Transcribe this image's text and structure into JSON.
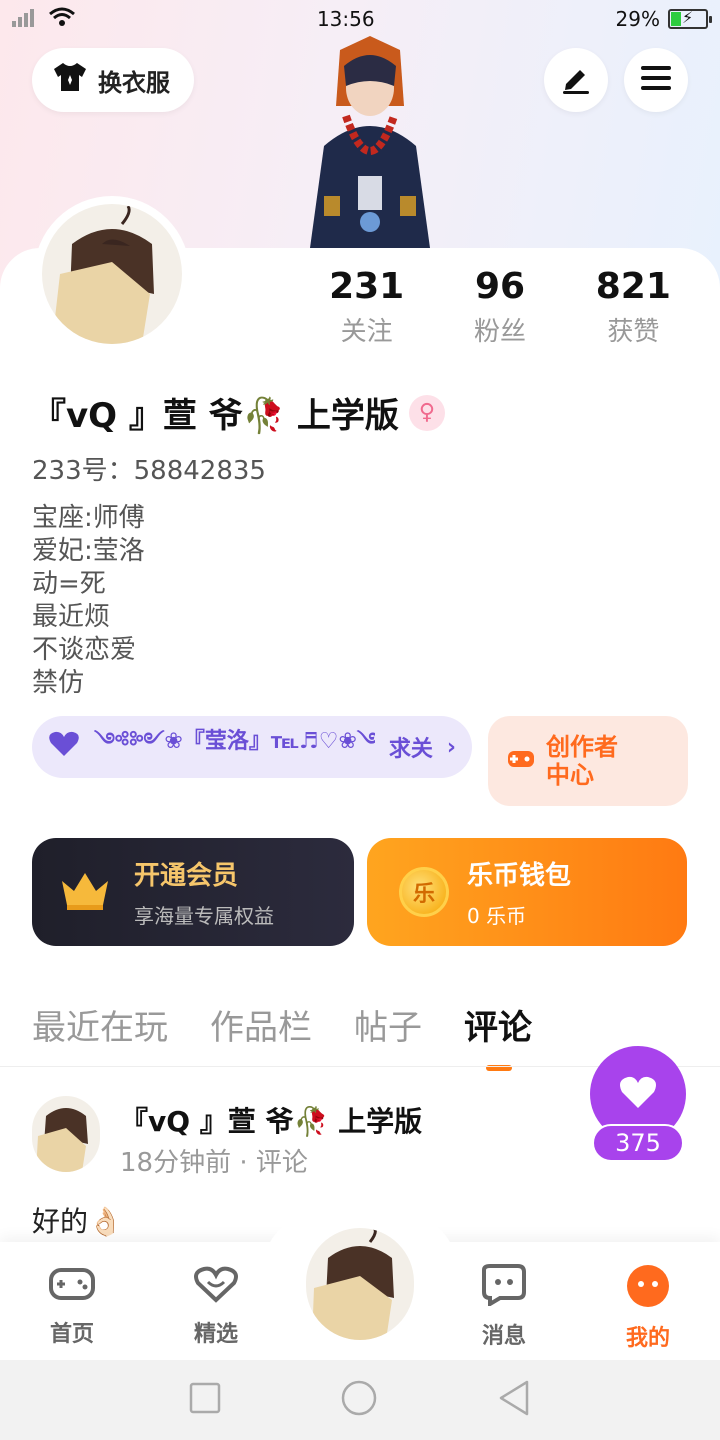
{
  "status": {
    "time": "13:56",
    "battery": "29%"
  },
  "header": {
    "dress_label": "换衣服"
  },
  "stats": [
    {
      "num": "231",
      "label": "关注"
    },
    {
      "num": "96",
      "label": "粉丝"
    },
    {
      "num": "821",
      "label": "获赞"
    }
  ],
  "profile": {
    "nickname": "『vQ 』萱 爷🥀 上学版",
    "uid": "233号：58842835",
    "bio": [
      "宝座:师傅",
      "爱妃:莹洛",
      "动=死",
      "最近烦",
      "不谈恋爱",
      "禁仿"
    ]
  },
  "guard": {
    "text": "༺༻❀『莹洛』℡♬♡❀༺༻",
    "action": "求关"
  },
  "creator": {
    "label_line1": "创作者",
    "label_line2": "中心"
  },
  "vip": {
    "title": "开通会员",
    "sub": "享海量专属权益"
  },
  "wallet": {
    "title": "乐币钱包",
    "sub": "0 乐币",
    "coin": "乐"
  },
  "tabs": [
    "最近在玩",
    "作品栏",
    "帖子",
    "评论"
  ],
  "comment": {
    "name": "『vQ 』萱 爷🥀 上学版",
    "meta": "18分钟前 · 评论",
    "text": "好的👌🏻",
    "likes": "375"
  },
  "nav": [
    "首页",
    "精选",
    "消息",
    "我的"
  ],
  "colors": {
    "accent": "#ff6a1e",
    "like": "#a843ec",
    "guard": "#6a4fd6"
  }
}
